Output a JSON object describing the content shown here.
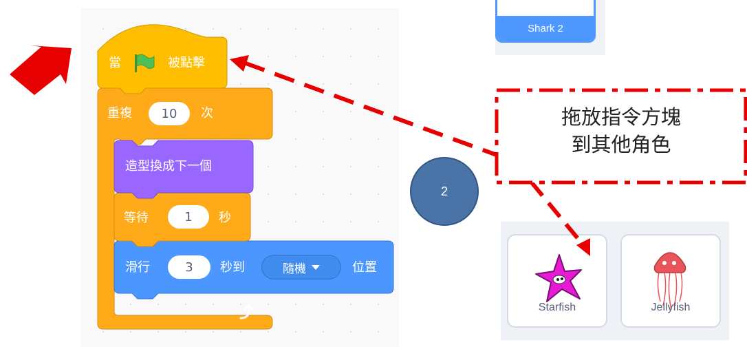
{
  "blocks": {
    "hat": {
      "when_label": "當",
      "clicked_label": "被點擊"
    },
    "repeat": {
      "label": "重複",
      "count": "10",
      "suffix": "次"
    },
    "next_costume": {
      "label": "造型換成下一個"
    },
    "wait": {
      "label": "等待",
      "seconds": "1",
      "suffix": "秒"
    },
    "glide": {
      "label": "滑行",
      "seconds": "3",
      "mid": "秒到",
      "target": "隨機",
      "suffix": "位置"
    }
  },
  "sprites": {
    "selected": {
      "name": "Shark 2"
    },
    "items": [
      {
        "name": "Starfish"
      },
      {
        "name": "Jellyfish"
      }
    ]
  },
  "annotation": {
    "callout_line1": "拖放指令方塊",
    "callout_line2": "到其他角色",
    "step": "2"
  },
  "colors": {
    "events": "#ffbf00",
    "control": "#ffab19",
    "looks": "#9966ff",
    "motion": "#4c97ff",
    "annotation_red": "#e60000",
    "step_circle": "#4a74a8"
  },
  "icons": [
    "green-flag-icon",
    "dropdown-arrow-icon",
    "loop-arrow-icon",
    "red-arrow-icon"
  ]
}
